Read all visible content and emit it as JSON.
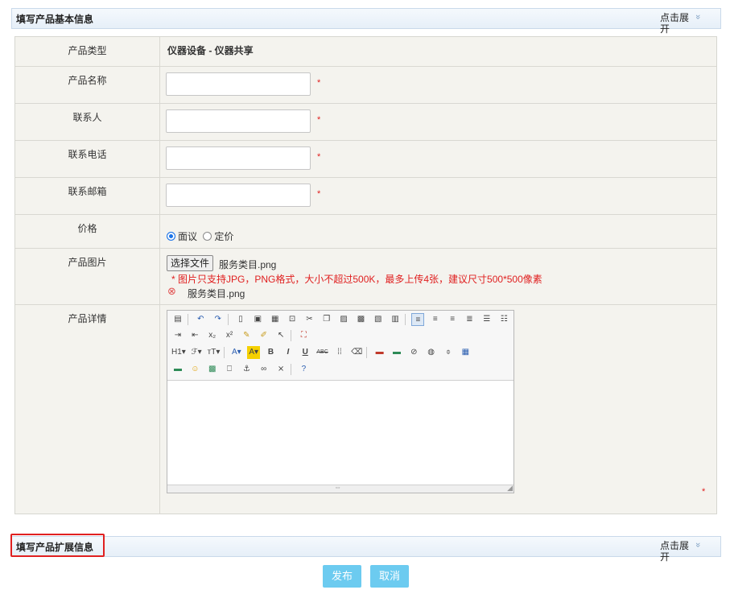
{
  "section_basic": {
    "title": "填写产品基本信息",
    "toggle": "点击展开",
    "chevron": "»"
  },
  "section_ext": {
    "title": "填写产品扩展信息",
    "toggle": "点击展开",
    "chevron": "»"
  },
  "form": {
    "product_type_label": "产品类型",
    "product_type_value": "仪器设备 - 仪器共享",
    "product_name_label": "产品名称",
    "contact_label": "联系人",
    "phone_label": "联系电话",
    "email_label": "联系邮箱",
    "price_label": "价格",
    "price_option_negotiable": "面议",
    "price_option_fixed": "定价",
    "image_label": "产品图片",
    "file_button": "选择文件",
    "chosen_file": "服务类目.png",
    "image_hint": "* 图片只支持JPG，PNG格式，大小不超过500K，最多上传4张，建议尺寸500*500像素",
    "uploaded_file": "服务类目.png",
    "detail_label": "产品详情",
    "required_mark": "*"
  },
  "toolbar": {
    "row1": [
      "source",
      "undo",
      "redo",
      "preview",
      "print",
      "template",
      "code",
      "cut",
      "copy",
      "paste",
      "paste-text",
      "paste-word",
      "select-all",
      "justify-left",
      "justify-center",
      "justify-right",
      "justify-full",
      "ordered-list",
      "unordered-list"
    ],
    "row3_text": {
      "h1": "H1▾",
      "font": "ℱ▾",
      "size": "тT▾",
      "color": "A▾",
      "bg": "A▾",
      "bold": "B",
      "italic": "I",
      "underline": "U",
      "strike": "ABC"
    }
  },
  "actions": {
    "publish": "发布",
    "cancel": "取消"
  },
  "colors": {
    "button": "#6ccbf0",
    "required": "#e02020",
    "header_border": "#c9d9ea"
  }
}
